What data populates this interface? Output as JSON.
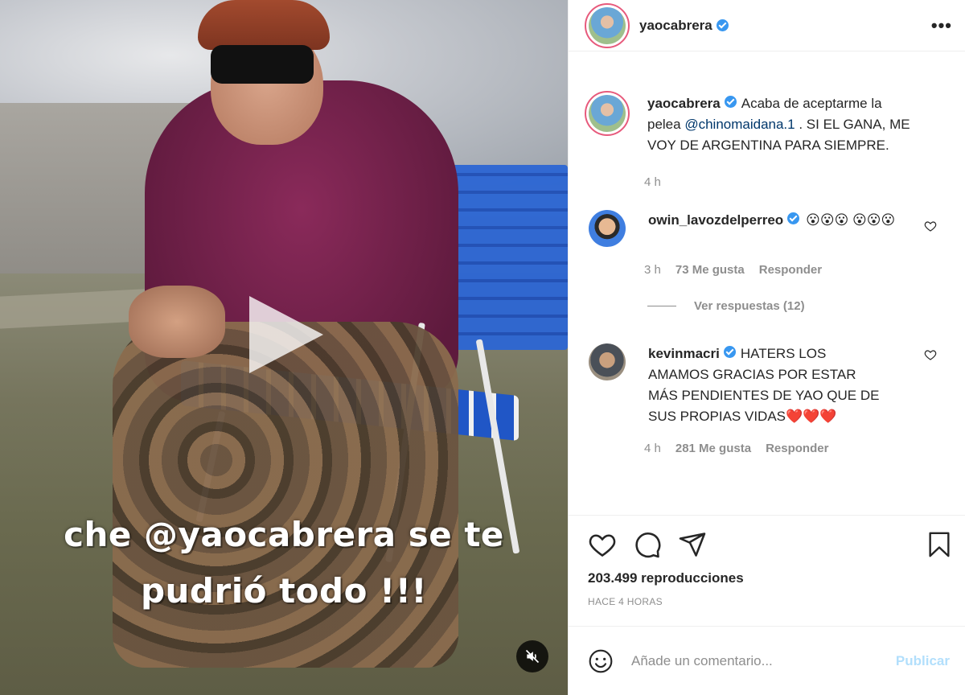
{
  "media": {
    "caption_line_1": "che @yaocabrera se te",
    "caption_line_2": "pudrió todo !!!",
    "play_icon": "play-icon",
    "mute_icon": "volume-muted-icon"
  },
  "header": {
    "username": "yaocabrera",
    "verified": true,
    "more_icon": "more-options-icon",
    "more_label": "•••"
  },
  "post": {
    "username": "yaocabrera",
    "caption_part_1": "Acaba de aceptarme la pelea ",
    "mention": "@chinomaidana.1",
    "caption_part_2": " . SI EL GANA, ME VOY DE ARGENTINA PARA SIEMPRE.",
    "time": "4 h"
  },
  "comments": [
    {
      "username": "owin_lavozdelperreo",
      "verified": true,
      "text": "😮😮😮 😮😮😮",
      "time": "3 h",
      "likes": "73 Me gusta",
      "reply": "Responder",
      "view_replies": "Ver respuestas (12)"
    },
    {
      "username": "kevinmacri",
      "verified": true,
      "text": "HATERS LOS AMAMOS GRACIAS POR ESTAR MÁS PENDIENTES DE YAO QUE DE SUS PROPIAS VIDAS❤️❤️❤️",
      "time": "4 h",
      "likes": "281 Me gusta",
      "reply": "Responder"
    }
  ],
  "actions": {
    "like_icon": "heart-icon",
    "comment_icon": "comment-icon",
    "share_icon": "share-icon",
    "save_icon": "bookmark-icon",
    "views": "203.499 reproducciones",
    "posted": "HACE 4 HORAS"
  },
  "add_comment": {
    "emoji_icon": "emoji-icon",
    "placeholder": "Añade un comentario...",
    "publish_label": "Publicar"
  },
  "colors": {
    "verified": "#3897f0",
    "mention": "#00376b",
    "publish_disabled": "#b2dffc",
    "muted_text": "#8e8e8e"
  }
}
